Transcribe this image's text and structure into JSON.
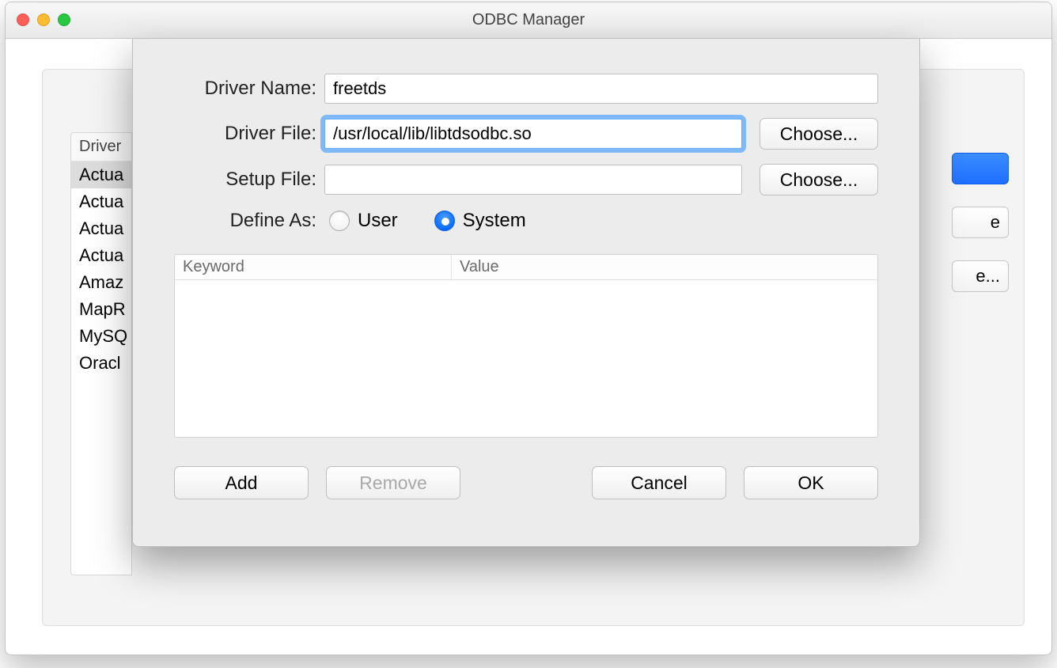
{
  "window": {
    "title": "ODBC Manager"
  },
  "bg_list": {
    "header": "Driver",
    "items": [
      "Actua",
      "Actua",
      "Actua",
      "Actua",
      "Amaz",
      "MapR",
      "MySQ",
      "Oracl"
    ],
    "selected_index": 0
  },
  "bg_buttons": {
    "mid": "e",
    "bot": "e..."
  },
  "sheet": {
    "labels": {
      "driver_name": "Driver Name:",
      "driver_file": "Driver File:",
      "setup_file": "Setup File:",
      "define_as": "Define As:"
    },
    "values": {
      "driver_name": "freetds",
      "driver_file": "/usr/local/lib/libtdsodbc.so",
      "setup_file": ""
    },
    "choose_label": "Choose...",
    "define_as": {
      "user": "User",
      "system": "System",
      "selected": "system"
    },
    "kv": {
      "keyword_header": "Keyword",
      "value_header": "Value",
      "rows": []
    },
    "buttons": {
      "add": "Add",
      "remove": "Remove",
      "cancel": "Cancel",
      "ok": "OK"
    },
    "remove_disabled": true
  }
}
